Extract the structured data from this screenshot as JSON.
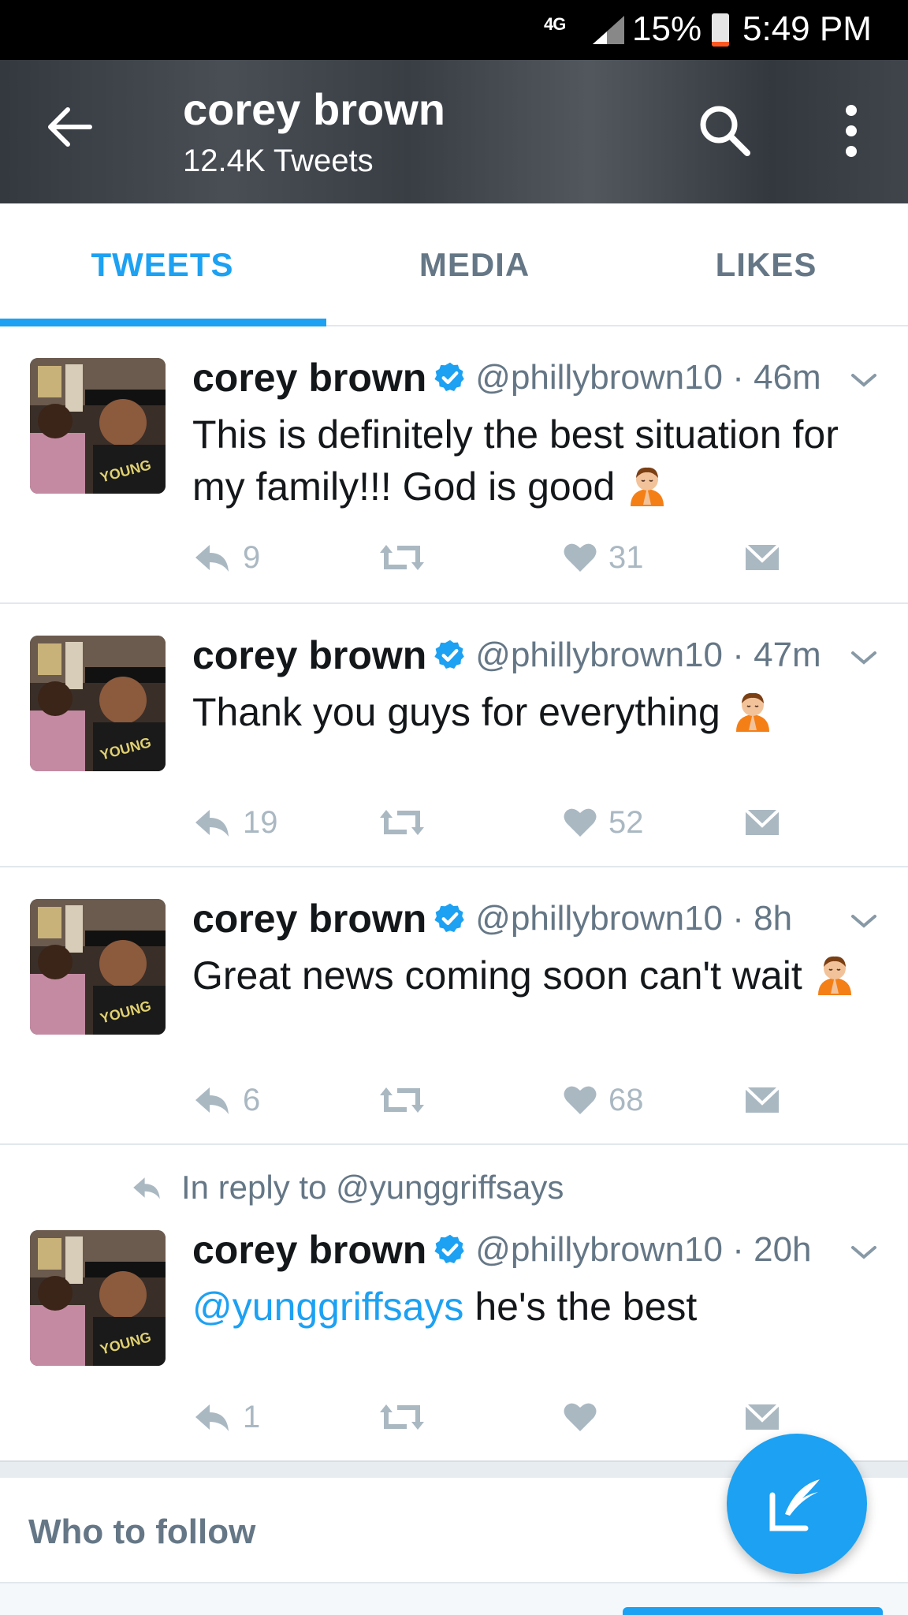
{
  "status_bar": {
    "network": "4G",
    "battery_percent": "15%",
    "battery_level": 0.15,
    "time": "5:49 PM"
  },
  "header": {
    "name": "corey brown",
    "tweet_count": "12.4K Tweets",
    "back_icon": "arrow-left-icon",
    "search_icon": "search-icon",
    "more_icon": "more-vertical-icon"
  },
  "tabs": [
    {
      "label": "TWEETS",
      "active": true
    },
    {
      "label": "MEDIA",
      "active": false
    },
    {
      "label": "LIKES",
      "active": false
    }
  ],
  "tweets": [
    {
      "reply_context": "",
      "name": "corey brown",
      "handle_time": "@phillybrown10 · 46m",
      "text": "This is definitely the best situation for my family!!! God is good",
      "emoji": "folded-hands-emoji",
      "replies": "9",
      "retweets": "",
      "likes": "31"
    },
    {
      "reply_context": "",
      "name": "corey brown",
      "handle_time": "@phillybrown10 · 47m",
      "text": "Thank you guys for everything",
      "emoji": "folded-hands-emoji",
      "replies": "19",
      "retweets": "",
      "likes": "52"
    },
    {
      "reply_context": "",
      "name": "corey brown",
      "handle_time": "@phillybrown10 · 8h",
      "text": "Great news coming soon can't wait",
      "emoji": "folded-hands-emoji",
      "replies": "6",
      "retweets": "",
      "likes": "68"
    },
    {
      "reply_context": "In reply to @yunggriffsays",
      "name": "corey brown",
      "handle_time": "@phillybrown10 · 20h",
      "mention": "@yunggriffsays",
      "text": " he's the best",
      "replies": "1",
      "retweets": "",
      "likes": ""
    }
  ],
  "who_to_follow": {
    "label": "Who to follow"
  },
  "compose_button": {
    "icon": "compose-tweet-icon"
  },
  "colors": {
    "accent": "#1da1f2",
    "text": "#14171a",
    "secondary": "#657786",
    "icon_gray": "#aab8c2"
  }
}
